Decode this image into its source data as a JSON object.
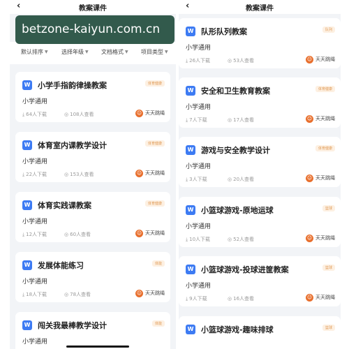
{
  "watermark": {
    "text": "betzone-kaiyun.com.cn"
  },
  "left_panel": {
    "title": "教案课件",
    "back_icon": "back-chevron-icon",
    "filters": [
      {
        "label": "默认排序"
      },
      {
        "label": "选择年级"
      },
      {
        "label": "文档格式"
      },
      {
        "label": "项目类型"
      }
    ],
    "cards": [
      {
        "title": "小学手指韵律操教案",
        "tag": "体育健康",
        "subtitle": "小学通用",
        "downloads": "64人下载",
        "views": "108人查看",
        "author": "天天跳绳"
      },
      {
        "title": "体育室内课教学设计",
        "tag": "体育健康",
        "subtitle": "小学通用",
        "downloads": "22人下载",
        "views": "153人查看",
        "author": "天天跳绳"
      },
      {
        "title": "体育实践课教案",
        "tag": "体育健康",
        "subtitle": "小学通用",
        "downloads": "12人下载",
        "views": "60人查看",
        "author": "天天跳绳"
      },
      {
        "title": "发展体能练习",
        "tag": "体能",
        "subtitle": "小学通用",
        "downloads": "18人下载",
        "views": "78人查看",
        "author": "天天跳绳"
      },
      {
        "title": "闯关我最棒教学设计",
        "tag": "体能",
        "subtitle": "小学通用",
        "downloads": "",
        "views": "",
        "author": ""
      }
    ]
  },
  "right_panel": {
    "title": "教案课件",
    "back_icon": "back-chevron-icon",
    "cards": [
      {
        "title": "队形队列教案",
        "tag": "队列",
        "subtitle": "小学通用",
        "downloads": "26人下载",
        "views": "53人查看",
        "author": "天天跳绳"
      },
      {
        "title": "安全和卫生教育教案",
        "tag": "体育健康",
        "subtitle": "小学通用",
        "downloads": "7人下载",
        "views": "17人查看",
        "author": "天天跳绳"
      },
      {
        "title": "游戏与安全教学设计",
        "tag": "体育健康",
        "subtitle": "小学通用",
        "downloads": "3人下载",
        "views": "20人查看",
        "author": "天天跳绳"
      },
      {
        "title": "小篮球游戏-原地运球",
        "tag": "篮球",
        "subtitle": "小学通用",
        "downloads": "10人下载",
        "views": "52人查看",
        "author": "天天跳绳"
      },
      {
        "title": "小篮球游戏-投球进筐教案",
        "tag": "篮球",
        "subtitle": "小学通用",
        "downloads": "9人下载",
        "views": "16人查看",
        "author": "天天跳绳"
      },
      {
        "title": "小篮球游戏-趣味排球",
        "tag": "篮球",
        "subtitle": "",
        "downloads": "",
        "views": "",
        "author": ""
      }
    ]
  },
  "icons": {
    "doc": "word-document-icon",
    "download": "download-icon",
    "views": "eye-icon",
    "author_avatar": "author-avatar-icon"
  },
  "colors": {
    "doc_icon": "#3d7bf3",
    "tag_bg": "#fdf0e2",
    "tag_text": "#e09a55",
    "avatar": "#e86f2d",
    "page_bg": "#f2f4f7"
  }
}
